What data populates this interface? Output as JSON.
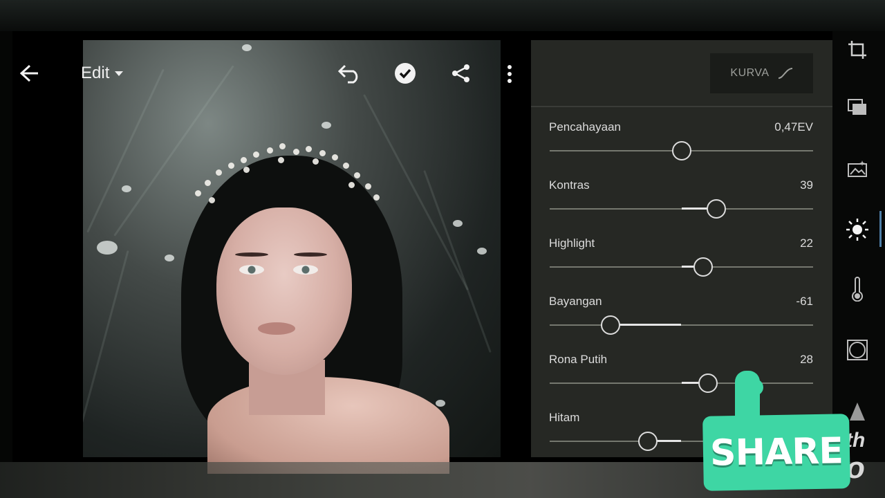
{
  "toolbar": {
    "back_icon": "back-arrow-icon",
    "mode_label": "Edit",
    "undo_icon": "undo-icon",
    "done_icon": "check-circle-icon",
    "share_icon": "share-icon",
    "more_icon": "more-vertical-icon"
  },
  "panel": {
    "curve_button": "KURVA",
    "sliders": [
      {
        "label": "Pencahayaan",
        "value": "0,47EV",
        "level": 0.47,
        "fill_from": null,
        "fill_to": null
      },
      {
        "label": "Kontras",
        "value": "39",
        "level": 0.6
      },
      {
        "label": "Highlight",
        "value": "22",
        "level": 0.55
      },
      {
        "label": "Bayangan",
        "value": "-61",
        "level": 0.2
      },
      {
        "label": "Rona Putih",
        "value": "28",
        "level": 0.57
      },
      {
        "label": "Hitam",
        "value": "",
        "level": 0.34
      }
    ]
  },
  "tools": [
    "crop-icon",
    "presets-icon",
    "auto-image-icon",
    "light-icon",
    "color-temperature-icon",
    "vignette-icon",
    "detail-icon"
  ],
  "overlay": {
    "share_text": "SHARE",
    "partial_text_1": "th",
    "partial_text_2": "o"
  },
  "colors": {
    "panel_bg": "#262824",
    "accent_active": "#4f7fa8",
    "share_green": "#3ed6a4"
  }
}
